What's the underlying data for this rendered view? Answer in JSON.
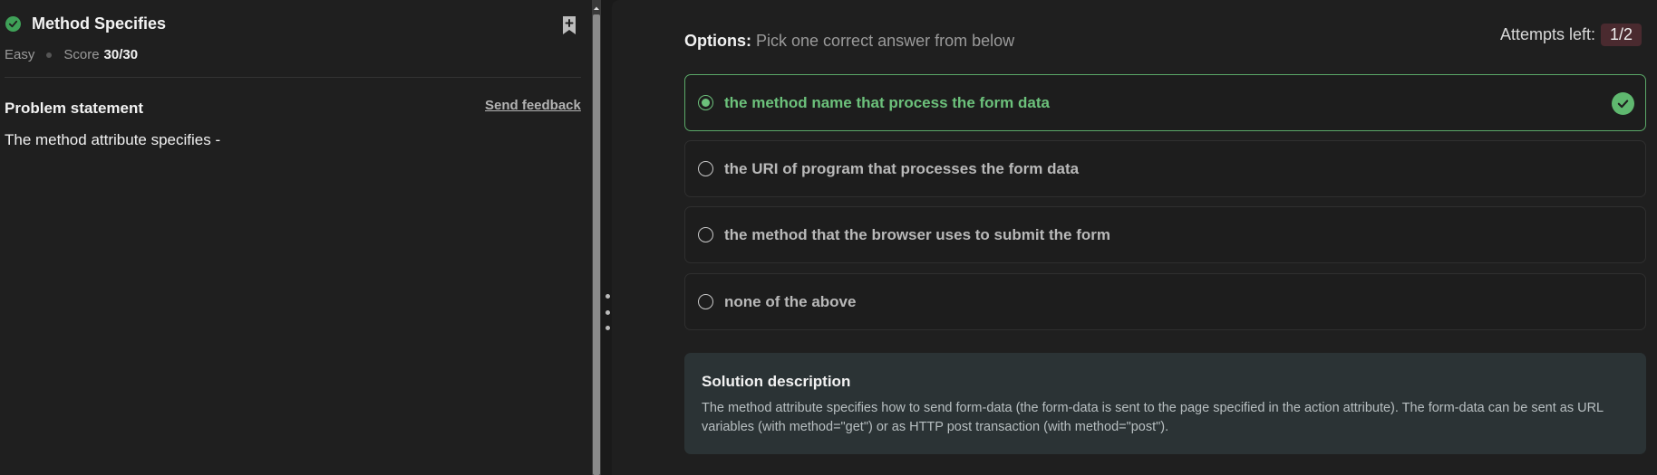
{
  "problem": {
    "title": "Method Specifies",
    "difficulty": "Easy",
    "score_label": "Score",
    "score_value": "30/30",
    "statement_heading": "Problem statement",
    "feedback_link": "Send feedback",
    "statement_text": "The method attribute specifies -",
    "status_icon": "check-circle-icon",
    "bookmark_icon": "bookmark-add-icon"
  },
  "question": {
    "options_label": "Options:",
    "options_hint": "Pick one correct answer from below",
    "attempts_label": "Attempts left:",
    "attempts_value": "1/2",
    "options": [
      {
        "label": "the method name that process the form data",
        "selected": true,
        "correct": true
      },
      {
        "label": "the URI of program that processes the form data",
        "selected": false,
        "correct": false
      },
      {
        "label": "the method that the browser uses to submit the form",
        "selected": false,
        "correct": false
      },
      {
        "label": "none of the above",
        "selected": false,
        "correct": false
      }
    ]
  },
  "solution": {
    "title": "Solution description",
    "text": "The method attribute specifies how to send form-data (the form-data is sent to the page specified in the action attribute). The form-data can be sent as URL variables (with method=\"get\") or as HTTP post transaction (with method=\"post\")."
  },
  "colors": {
    "success": "#5fb86f",
    "attempts_badge": "#4a2a2f",
    "solution_bg": "#2b3335"
  }
}
